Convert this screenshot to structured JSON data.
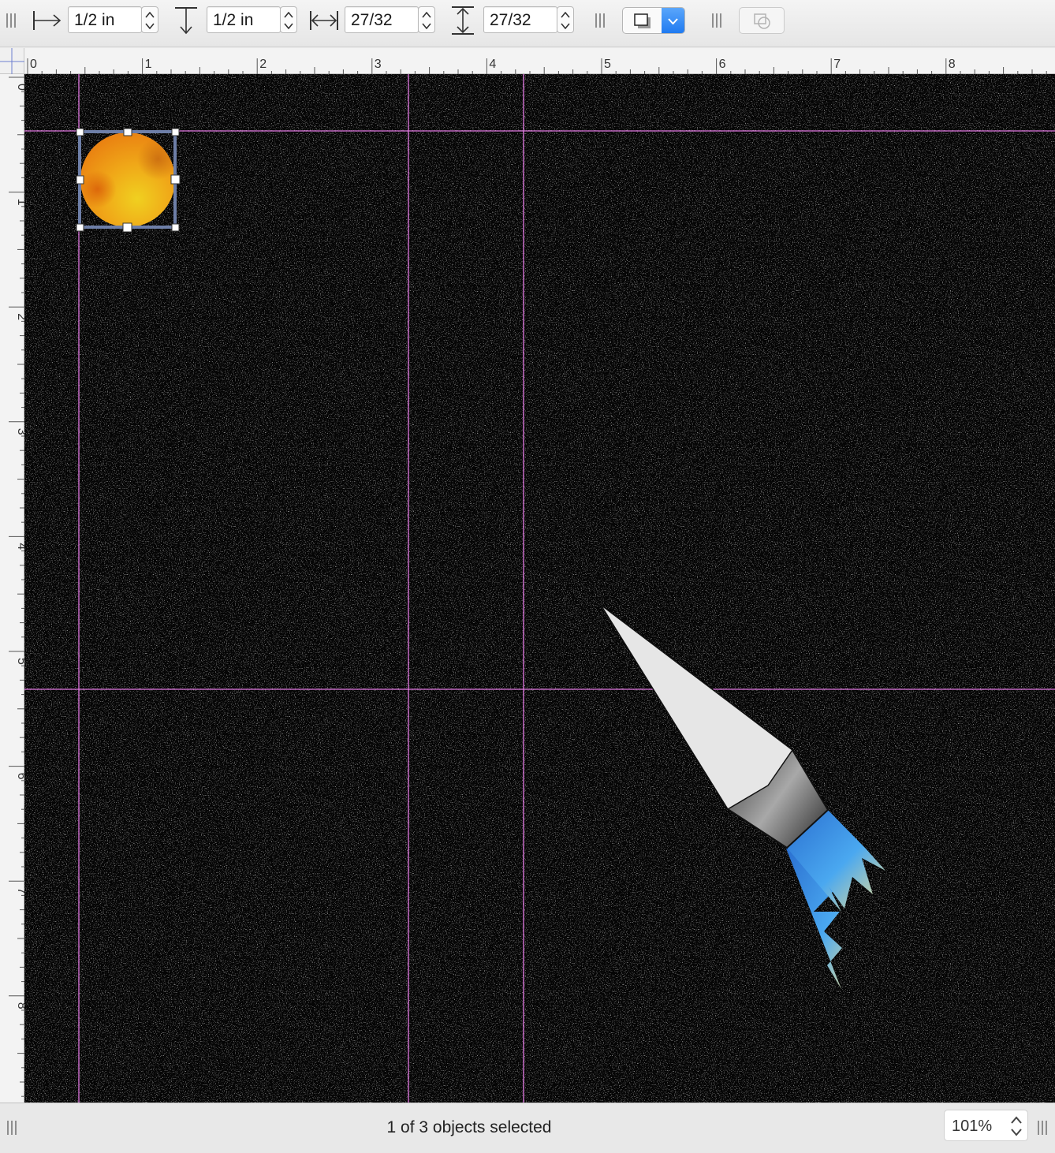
{
  "toolbar": {
    "x_position": "1/2 in",
    "y_position": "1/2 in",
    "width": "27/32",
    "height": "27/32",
    "icons": [
      "x-position-icon",
      "y-position-icon",
      "width-icon",
      "height-icon",
      "shadow-style-icon",
      "combine-shapes-icon"
    ]
  },
  "rulers": {
    "horizontal_labels": [
      "0",
      "1",
      "2",
      "3",
      "4",
      "5",
      "6",
      "7",
      "8"
    ],
    "vertical_labels": [
      "0",
      "1",
      "2",
      "3",
      "4",
      "5",
      "6",
      "7",
      "8"
    ]
  },
  "canvas": {
    "background": "#050505",
    "guide_color": "#e47ae4",
    "selection_color": "#6e7fa8",
    "objects": [
      "sun",
      "rocket-body",
      "rocket-flame"
    ],
    "selected_object": "sun"
  },
  "status": {
    "selection_text": "1 of 3 objects selected",
    "zoom": "101%"
  },
  "colors": {
    "accent_blue": "#1c78f0",
    "sun_orange": "#f08a12",
    "sun_yellow": "#f0d020",
    "flame_blue": "#3d9ef0"
  }
}
